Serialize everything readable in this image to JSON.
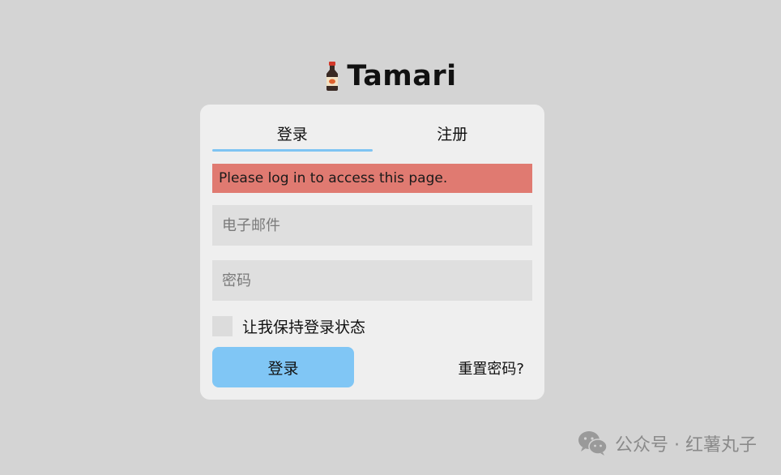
{
  "brand": {
    "title": "Tamari",
    "icon": "soy-sauce-bottle-icon"
  },
  "tabs": [
    {
      "label": "登录",
      "active": true
    },
    {
      "label": "注册",
      "active": false
    }
  ],
  "alert": {
    "message": "Please log in to access this page."
  },
  "form": {
    "email_placeholder": "电子邮件",
    "password_placeholder": "密码",
    "remember_label": "让我保持登录状态",
    "login_label": "登录",
    "reset_label": "重置密码?"
  },
  "watermark": {
    "text": "公众号 · 红薯丸子",
    "icon": "wechat-icon"
  },
  "colors": {
    "background": "#d4d4d4",
    "card": "#efefef",
    "accent": "#80c6f5",
    "alert": "#e07a71",
    "field": "#dfdfdf"
  }
}
